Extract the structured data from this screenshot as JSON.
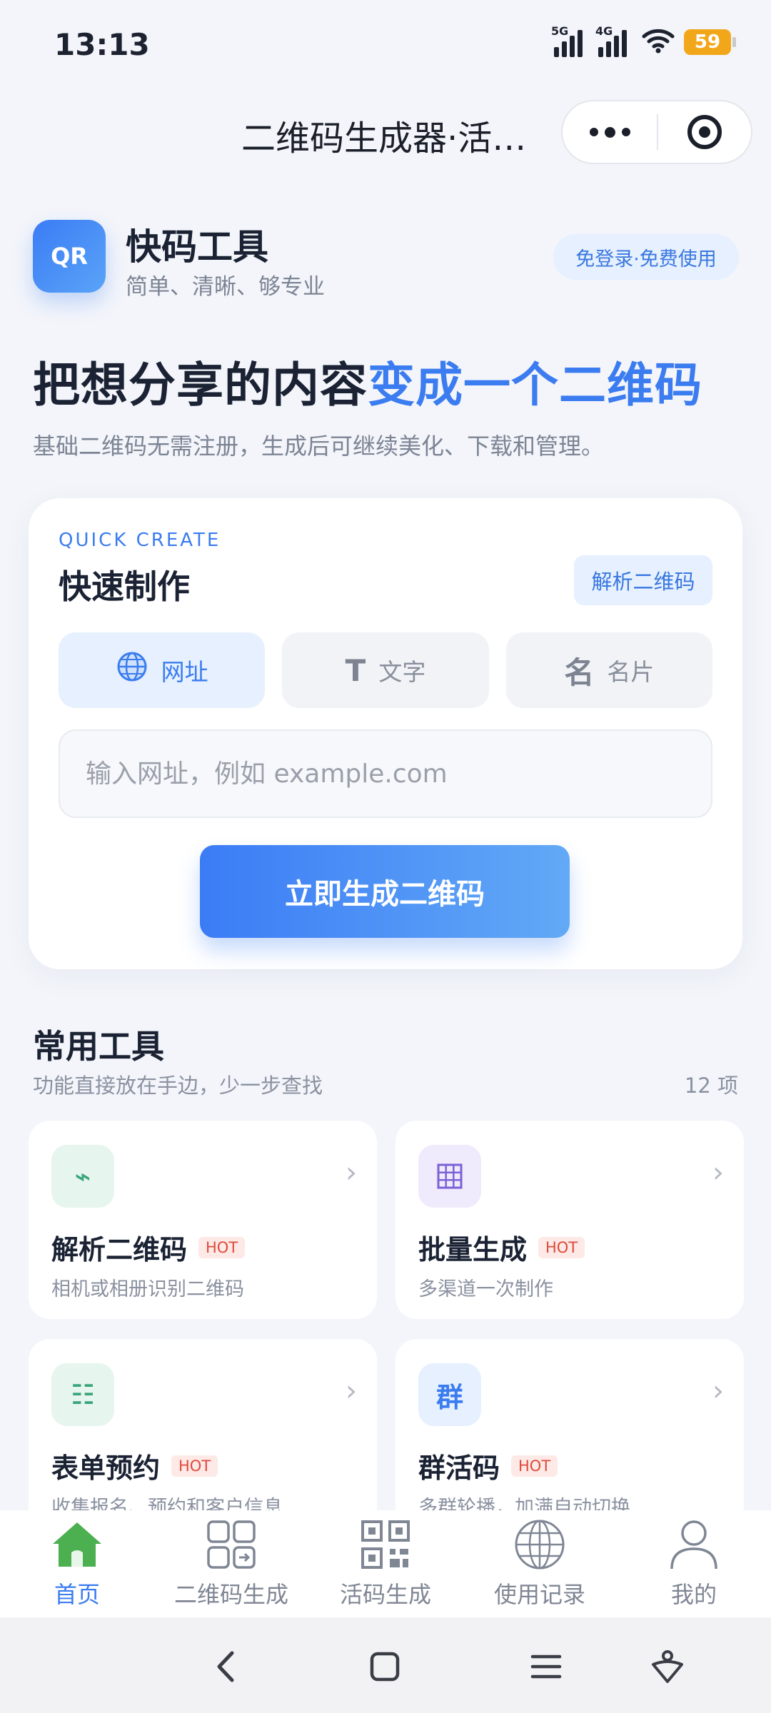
{
  "status_bar": {
    "time": "13:13",
    "network1": "5G",
    "network2": "4G",
    "battery": "59"
  },
  "title_bar": {
    "title": "二维码生成器·活码生成"
  },
  "brand": {
    "logo_text": "QR",
    "name": "快码工具",
    "slogan": "简单、清晰、够专业",
    "badge": "免登录·免费使用"
  },
  "hero": {
    "headline_part1": "把想分享的内容",
    "headline_part2": "变成一个二维码",
    "subline": "基础二维码无需注册，生成后可继续美化、下载和管理。"
  },
  "quick_create": {
    "label_en": "QUICK CREATE",
    "title": "快速制作",
    "parse_button": "解析二维码",
    "tabs": [
      {
        "label": "网址",
        "icon": "globe-icon",
        "glyph": "🌐",
        "active": true
      },
      {
        "label": "文字",
        "icon": "text-icon",
        "glyph": "T",
        "active": false
      },
      {
        "label": "名片",
        "icon": "card-icon",
        "glyph": "名",
        "active": false
      }
    ],
    "input_placeholder": "输入网址，例如 example.com",
    "input_value": "",
    "generate_button": "立即生成二维码"
  },
  "tools": {
    "title": "常用工具",
    "subtitle": "功能直接放在手边，少一步查找",
    "count": "12 项",
    "hot_label": "HOT",
    "items": [
      {
        "name": "解析二维码",
        "desc": "相机或相册识别二维码",
        "icon": "scan-icon",
        "glyph": "⌁",
        "color": "#3aa57a",
        "bg": "#e6f5ee",
        "hot": true
      },
      {
        "name": "批量生成",
        "desc": "多渠道一次制作",
        "icon": "grid-icon",
        "glyph": "▦",
        "color": "#7b62d6",
        "bg": "#efeafc",
        "hot": true
      },
      {
        "name": "表单预约",
        "desc": "收集报名、预约和客户信息",
        "icon": "form-icon",
        "glyph": "☷",
        "color": "#3aa57a",
        "bg": "#e6f5ee",
        "hot": true
      },
      {
        "name": "群活码",
        "desc": "多群轮播，加满自动切换",
        "icon": "group-icon",
        "glyph": "群",
        "color": "#3b7cf0",
        "bg": "#e6f0fe",
        "hot": true
      }
    ]
  },
  "bottom_nav": [
    {
      "label": "首页",
      "icon": "home-icon",
      "active": true
    },
    {
      "label": "二维码生成",
      "icon": "qr-generate-icon",
      "active": false
    },
    {
      "label": "活码生成",
      "icon": "qr-code-icon",
      "active": false
    },
    {
      "label": "使用记录",
      "icon": "globe-icon",
      "active": false
    },
    {
      "label": "我的",
      "icon": "user-icon",
      "active": false
    }
  ],
  "colors": {
    "accent": "#3b7cf0",
    "hot": "#e04a3c",
    "battery": "#f2a71b",
    "home_icon": "#4caf50"
  }
}
